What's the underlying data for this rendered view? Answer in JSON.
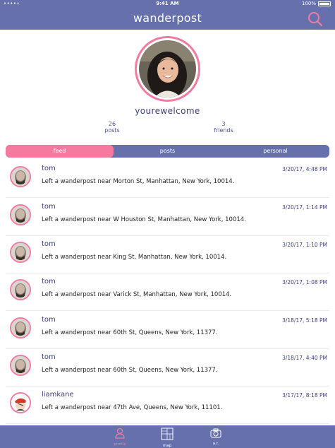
{
  "status_bar": {
    "signal": "•••••",
    "time": "9:41 AM",
    "battery": "100%"
  },
  "nav": {
    "title": "wanderpost",
    "search_icon": "search-icon"
  },
  "profile": {
    "username": "yourewelcome",
    "posts_count": "26",
    "posts_label": "posts",
    "friends_count": "3",
    "friends_label": "friends"
  },
  "tabs": [
    {
      "label": "feed",
      "active": true
    },
    {
      "label": "posts",
      "active": false
    },
    {
      "label": "personal",
      "active": false
    }
  ],
  "feed": [
    {
      "name": "tom",
      "time": "3/20/17, 4:48 PM",
      "message": "Left a wanderpost near Morton St, Manhattan, New York, 10014."
    },
    {
      "name": "tom",
      "time": "3/20/17, 1:14 PM",
      "message": "Left a wanderpost near W Houston St, Manhattan, New York, 10014."
    },
    {
      "name": "tom",
      "time": "3/20/17, 1:10 PM",
      "message": "Left a wanderpost near King St, Manhattan, New York, 10014."
    },
    {
      "name": "tom",
      "time": "3/20/17, 1:08 PM",
      "message": "Left a wanderpost near Varick St, Manhattan, New York, 10014."
    },
    {
      "name": "tom",
      "time": "3/18/17, 5:18 PM",
      "message": "Left a wanderpost near 60th St, Queens, New York, 11377."
    },
    {
      "name": "tom",
      "time": "3/18/17, 4:40 PM",
      "message": "Left a wanderpost near 60th St, Queens, New York, 11377."
    },
    {
      "name": "liamkane",
      "time": "3/17/17, 8:18 PM",
      "message": "Left a wanderpost near 47th Ave, Queens, New York, 11101."
    }
  ],
  "tab_bar": [
    {
      "label": "profile",
      "icon": "person-icon",
      "active": true
    },
    {
      "label": "map",
      "icon": "map-icon",
      "active": false
    },
    {
      "label": "a.r.",
      "icon": "camera-icon",
      "active": false
    }
  ],
  "colors": {
    "brand": "#6670ad",
    "accent": "#f47aa0"
  }
}
